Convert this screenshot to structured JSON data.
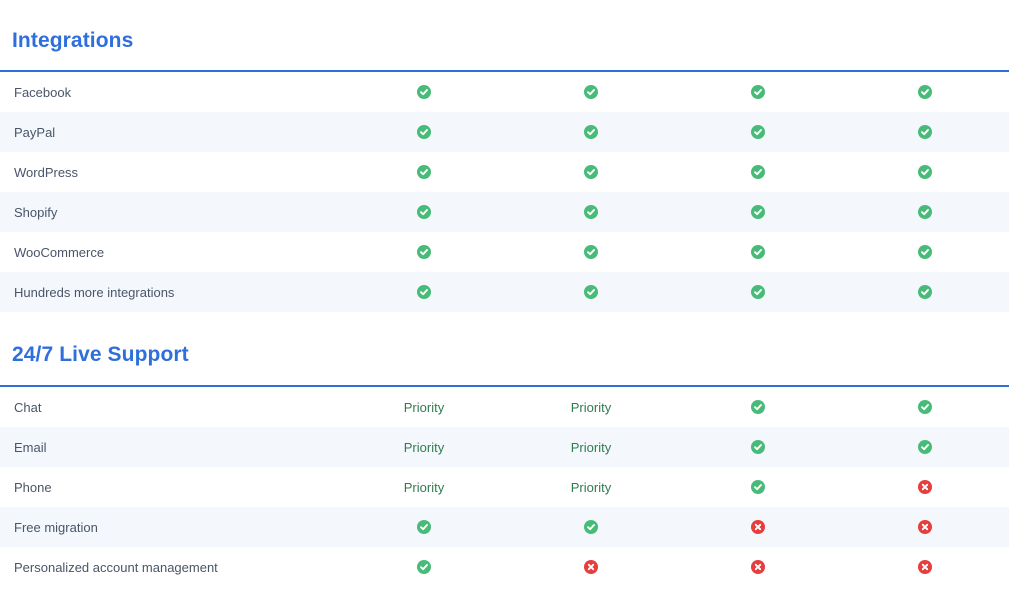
{
  "colors": {
    "accent": "#2f6fdb",
    "check": "#48bb78",
    "cross": "#e53e3e",
    "priority_text": "#2e7d4f"
  },
  "sections": [
    {
      "title": "Integrations",
      "rows": [
        {
          "label": "Facebook",
          "cells": [
            "check",
            "check",
            "check",
            "check"
          ]
        },
        {
          "label": "PayPal",
          "cells": [
            "check",
            "check",
            "check",
            "check"
          ]
        },
        {
          "label": "WordPress",
          "cells": [
            "check",
            "check",
            "check",
            "check"
          ]
        },
        {
          "label": "Shopify",
          "cells": [
            "check",
            "check",
            "check",
            "check"
          ]
        },
        {
          "label": "WooCommerce",
          "cells": [
            "check",
            "check",
            "check",
            "check"
          ]
        },
        {
          "label": "Hundreds more integrations",
          "cells": [
            "check",
            "check",
            "check",
            "check"
          ]
        }
      ]
    },
    {
      "title": "24/7 Live Support",
      "rows": [
        {
          "label": "Chat",
          "cells": [
            "Priority",
            "Priority",
            "check",
            "check"
          ]
        },
        {
          "label": "Email",
          "cells": [
            "Priority",
            "Priority",
            "check",
            "check"
          ]
        },
        {
          "label": "Phone",
          "cells": [
            "Priority",
            "Priority",
            "check",
            "cross"
          ]
        },
        {
          "label": "Free migration",
          "cells": [
            "check",
            "check",
            "cross",
            "cross"
          ]
        },
        {
          "label": "Personalized account management",
          "cells": [
            "check",
            "cross",
            "cross",
            "cross"
          ]
        }
      ]
    }
  ]
}
